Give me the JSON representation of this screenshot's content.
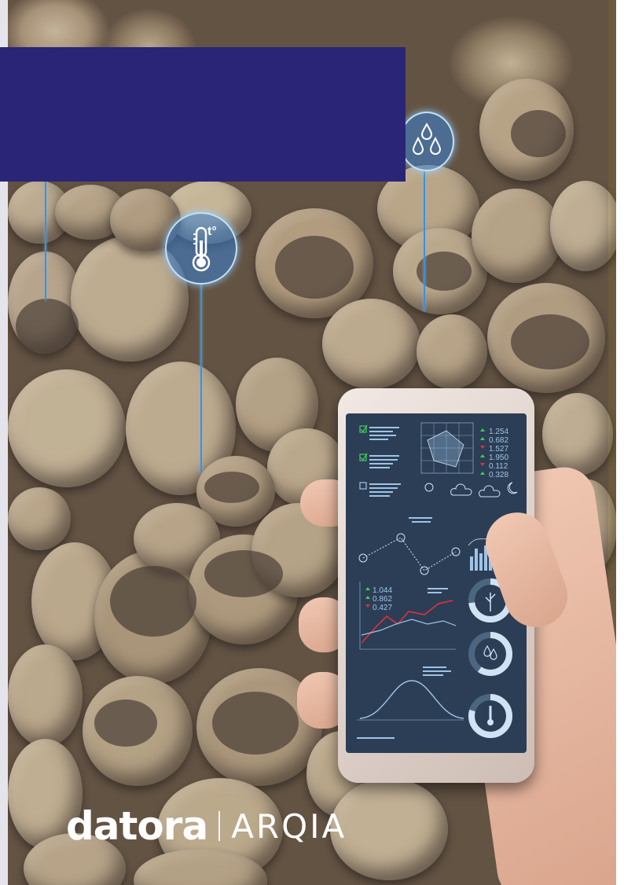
{
  "brand": {
    "logo_primary": "datora",
    "logo_secondary": "ARQIA",
    "banner_color": "#2b2577"
  },
  "sensors": [
    {
      "icon": "thermometer-icon",
      "label": "t°"
    },
    {
      "icon": "water-drops-icon"
    }
  ],
  "phone_screen": {
    "readings_top": [
      "1.254",
      "0.682",
      "1.527",
      "1.950",
      "0.112",
      "0.328"
    ],
    "readings_mid": [
      "1.044",
      "0.862",
      "0.427"
    ],
    "colors": {
      "up": "#3ecf5a",
      "down": "#e0323c",
      "accent": "#5fb0e8"
    }
  }
}
